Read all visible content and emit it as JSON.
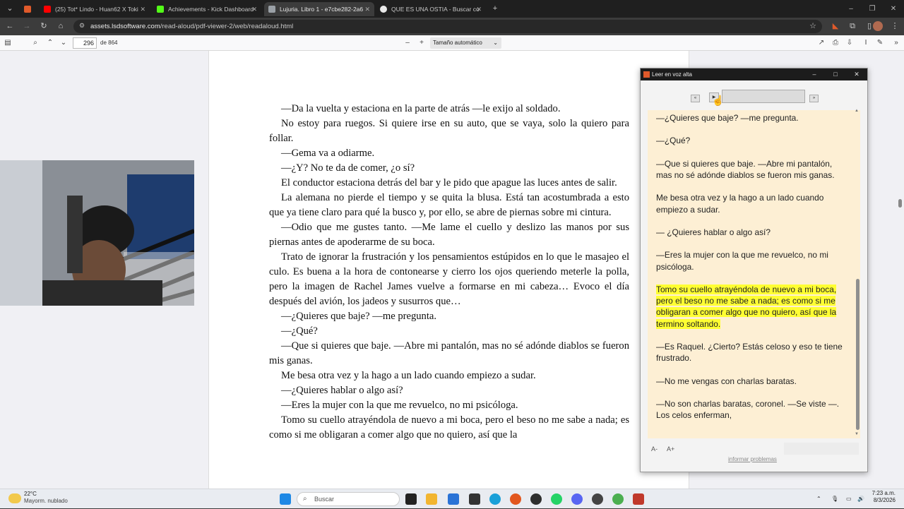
{
  "browser": {
    "tabs": [
      {
        "label": "",
        "favicon_color": "#e05a2b"
      },
      {
        "label": "(25) Tot* Lindo - Huan62 X Toki",
        "favicon_color": "#ff0000"
      },
      {
        "label": "Achievements - Kick Dashboard",
        "favicon_color": "#53fc18"
      },
      {
        "label": "Lujuria. Libro 1 - e7cbe282-2a6",
        "favicon_color": "#9aa0a6"
      },
      {
        "label": "QUE ES UNA OSTIA - Buscar co",
        "favicon_color": "#e8e8e8"
      }
    ],
    "url_host": "assets.lsdsoftware.com",
    "url_path": "/read-aloud/pdf-viewer-2/web/readaloud.html"
  },
  "pdf_toolbar": {
    "page_number": "296",
    "page_count": "de 864",
    "zoom": "Tamaño automático"
  },
  "page_paragraphs": [
    "—Da la vuelta y estaciona en la parte de atrás —le exijo al soldado.",
    "No estoy para ruegos. Si quiere irse en su auto, que se vaya, solo la quiero para follar.",
    "—Gema va a odiarme.",
    "—¿Y? No te da de comer, ¿o sí?",
    "El conductor estaciona detrás del bar y le pido que apague las luces antes de salir.",
    "La alemana no pierde el tiempo y se quita la blusa. Está tan acostumbrada a esto que ya tiene claro para qué la busco y, por ello, se abre de piernas sobre mi cintura.",
    "—Odio que me gustes tanto. —Me lame el cuello y deslizo las manos por sus piernas antes de apoderarme de su boca.",
    "Trato de ignorar la frustración y los pensamientos estúpidos en lo que le masajeo el culo. Es buena a la hora de contonearse y cierro los ojos queriendo meterle la polla, pero la imagen de Rachel James vuelve a formarse en mi cabeza… Evoco el día después del avión, los jadeos y susurros que…",
    "—¿Quieres que baje? —me pregunta.",
    "—¿Qué?",
    "—Que si quieres que baje. —Abre mi pantalón, mas no sé adónde diablos se fueron mis ganas.",
    "Me besa otra vez y la hago a un lado cuando empiezo a sudar.",
    "—¿Quieres hablar o algo así?",
    "—Eres la mujer con la que me revuelco, no mi psicóloga.",
    "Tomo su cuello atrayéndola de nuevo a mi boca, pero el beso no me sabe a nada; es como si me obligaran a comer algo que no quiero, así que la"
  ],
  "read_aloud": {
    "title": "Leer en voz alta",
    "paragraphs": [
      "—¿Quieres que baje? —me pregunta.",
      "—¿Qué?",
      "—Que si quieres que baje. —Abre mi pantalón, mas no sé adónde diablos se fueron mis ganas.",
      "Me besa otra vez y la hago a un lado cuando empiezo a sudar.",
      "— ¿Quieres hablar o algo así?",
      "—Eres la mujer con la que me revuelco, no mi psicóloga.",
      "Tomo su cuello atrayéndola de nuevo a mi boca, pero el beso no me sabe a nada; es como si me obligaran a comer algo que no quiero, así que la termino soltando.",
      "—Es Raquel. ¿Cierto? Estás celoso y eso te tiene frustrado.",
      "—No me vengas con charlas baratas.",
      "—No son charlas baratas, coronel. —Se viste —. Los celos enferman,"
    ],
    "highlighted_index": 6,
    "font_smaller": "A-",
    "font_larger": "A+",
    "report_link": "informar problemas",
    "highlight_color": "#ffff33",
    "panel_bg": "#fdefd4"
  },
  "taskbar": {
    "weather_temp": "22°C",
    "weather_desc": "Mayorm. nublado",
    "search_placeholder": "Buscar",
    "time": "7:23 a.m.",
    "date": "8/3/2026"
  }
}
